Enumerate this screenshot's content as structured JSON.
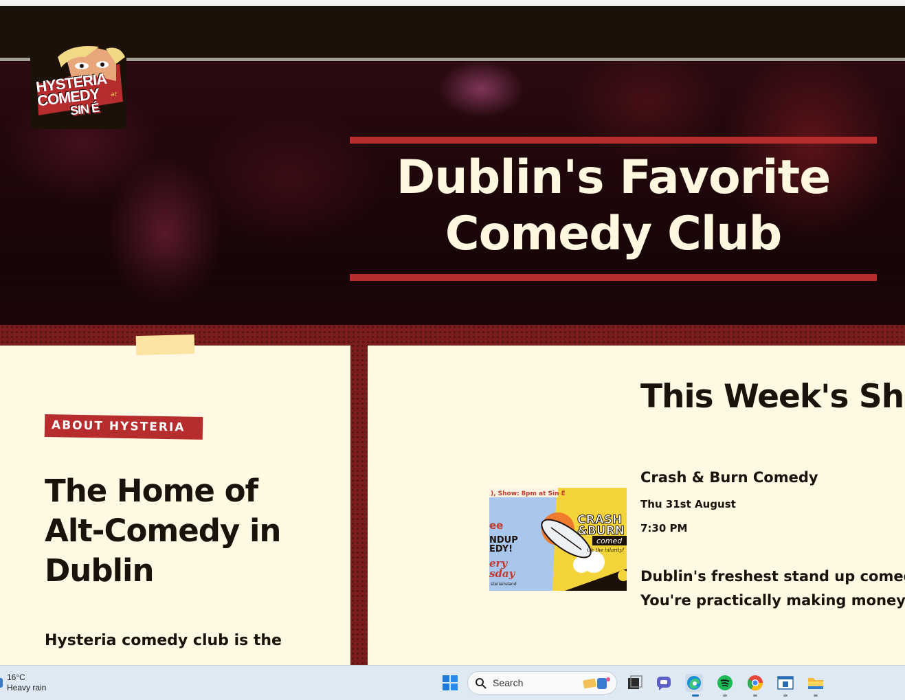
{
  "logo": {
    "line1": "HYSTERIA",
    "line2": "COMEDY",
    "at": "at",
    "line3": "SIN É"
  },
  "hero": {
    "title_line1": "Dublin's Favorite",
    "title_line2": "Comedy Club"
  },
  "about": {
    "tag": "ABOUT HYSTERIA",
    "heading_line1": "The Home of",
    "heading_line2": "Alt-Comedy in",
    "heading_line3": "Dublin",
    "text": "Hysteria comedy club is the"
  },
  "shows": {
    "heading": "This Week's Sho",
    "items": [
      {
        "title": "Crash & Burn Comedy",
        "date": "Thu 31st August",
        "time": "7:30 PM",
        "desc_line1": "Dublin's freshest stand up comedy -",
        "desc_line2": "You're practically making money by",
        "thumb": {
          "banner": "), Show: 8pm at Sin É",
          "side1": "ee",
          "side2": "NDUP",
          "side3": "EDY!",
          "side4": "ery",
          "side5": "sday",
          "brand_line1": "CRASH",
          "brand_line2": "&BURN",
          "brand_line3": "comed",
          "tagline": "Oh the hilarity!",
          "handle": "steriaireland"
        }
      }
    ]
  },
  "taskbar": {
    "weather_temp": "16°C",
    "weather_desc": "Heavy rain",
    "search_placeholder": "Search",
    "icons": [
      "windows-start-icon",
      "search-icon",
      "task-view-icon",
      "teams-chat-icon",
      "edge-icon",
      "spotify-icon",
      "chrome-icon",
      "app-window-icon",
      "file-explorer-icon"
    ]
  },
  "colors": {
    "accent_red": "#b72d2e",
    "cream": "#fff8e3",
    "dark": "#1a120b",
    "band": "#7a1d1d"
  }
}
